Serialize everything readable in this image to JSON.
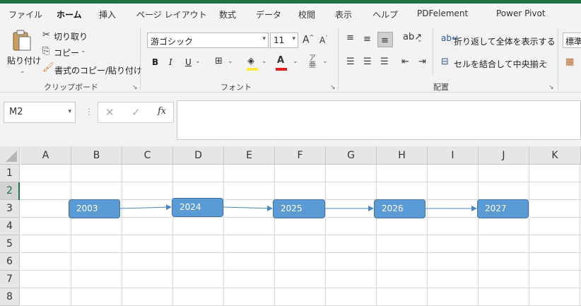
{
  "tabs": [
    "ファイル",
    "ホーム",
    "挿入",
    "ページ レイアウト",
    "数式",
    "データ",
    "校閲",
    "表示",
    "ヘルプ",
    "PDFelement",
    "Power Pivot"
  ],
  "clipboard": {
    "paste": "貼り付け",
    "cut": "切り取り",
    "copy": "コピー",
    "format_painter": "書式のコピー/貼り付け",
    "group": "クリップボード"
  },
  "font": {
    "name": "游ゴシック",
    "size": "11",
    "bold": "B",
    "italic": "I",
    "underline": "U",
    "group": "フォント"
  },
  "alignment": {
    "wrap_text": "折り返して全体を表示する",
    "merge_center": "セルを結合して中央揃え",
    "group": "配置"
  },
  "number": {
    "format": "標準"
  },
  "formula_bar": {
    "name_box": "M2",
    "cancel": "✕",
    "enter": "✓",
    "fx": "fx",
    "value": ""
  },
  "columns": [
    "A",
    "B",
    "C",
    "D",
    "E",
    "F",
    "G",
    "H",
    "I",
    "J",
    "K"
  ],
  "rows": [
    "1",
    "2",
    "3",
    "4",
    "5",
    "6",
    "7",
    "8"
  ],
  "selected_row": "2",
  "shapes": [
    "2003",
    "2024",
    "2025",
    "2026",
    "2027"
  ],
  "colors": {
    "accent": "#217346",
    "shape_fill": "#5b9bd5",
    "shape_border": "#41719c",
    "arrow": "#4a86c5"
  }
}
